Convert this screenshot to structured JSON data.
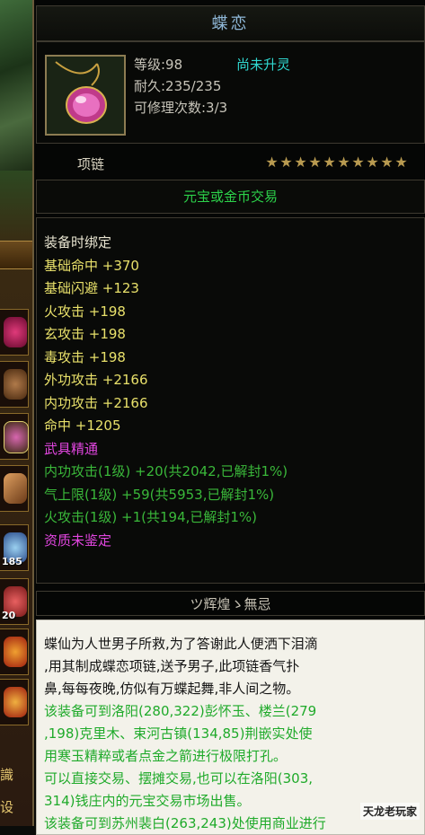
{
  "side": {
    "slot_counts": [
      "185",
      "20"
    ],
    "text_1": "識",
    "text_2": "设"
  },
  "item": {
    "name": "蝶恋",
    "level": "等级:98",
    "refine_status": "尚未升灵",
    "durability": "耐久:235/235",
    "repairs": "可修理次数:3/3",
    "type": "项链",
    "stars_total": 10,
    "stars_filled": 10,
    "trade_mode": "元宝或金币交易",
    "set_name": "ツ辉煌ゝ無忌",
    "icon": "pink-gem-pendant-icon",
    "colors": {
      "title": "#8fb8d8",
      "yellow": "#e8e06a",
      "green": "#3ab83a",
      "pink": "#e246e0",
      "cyan": "#30d8d0"
    }
  },
  "stats": [
    {
      "text": "装备时绑定",
      "color": "white"
    },
    {
      "text": "基础命中 +370",
      "color": "yellow"
    },
    {
      "text": "基础闪避 +123",
      "color": "yellow"
    },
    {
      "text": "火攻击 +198",
      "color": "yellow"
    },
    {
      "text": "玄攻击 +198",
      "color": "yellow"
    },
    {
      "text": "毒攻击 +198",
      "color": "yellow"
    },
    {
      "text": "外功攻击 +2166",
      "color": "yellow"
    },
    {
      "text": "内功攻击 +2166",
      "color": "yellow"
    },
    {
      "text": "命中 +1205",
      "color": "yellow"
    },
    {
      "text": "武具精通",
      "color": "pink"
    },
    {
      "text": "内功攻击(1级) +20(共2042,已解封1%)",
      "color": "green"
    },
    {
      "text": "气上限(1级) +59(共5953,已解封1%)",
      "color": "green"
    },
    {
      "text": "火攻击(1级) +1(共194,已解封1%)",
      "color": "green"
    },
    {
      "text": "资质未鉴定",
      "color": "pink"
    }
  ],
  "description": [
    {
      "text": "蝶仙为人世男子所救,为了答谢此人便洒下泪滴",
      "color": "dark"
    },
    {
      "text": ",用其制成蝶恋项链,送予男子,此项链香气扑",
      "color": "dark"
    },
    {
      "text": "鼻,每每夜晚,仿似有万蝶起舞,非人间之物。",
      "color": "dark"
    },
    {
      "text": "该装备可到洛阳(280,322)彭怀玉、楼兰(279",
      "color": "green"
    },
    {
      "text": ",198)克里木、束河古镇(134,85)荆嵌实处使",
      "color": "green"
    },
    {
      "text": "用寒玉精粹或者点金之箭进行极限打孔。",
      "color": "green"
    },
    {
      "text": "可以直接交易、摆摊交易,也可以在洛阳(303,",
      "color": "green"
    },
    {
      "text": "314)钱庄内的元宝交易市场出售。",
      "color": "green"
    },
    {
      "text": "该装备可到苏州裴白(263,243)处使用商业进行",
      "color": "green"
    }
  ],
  "watermark": "天龙老玩家"
}
